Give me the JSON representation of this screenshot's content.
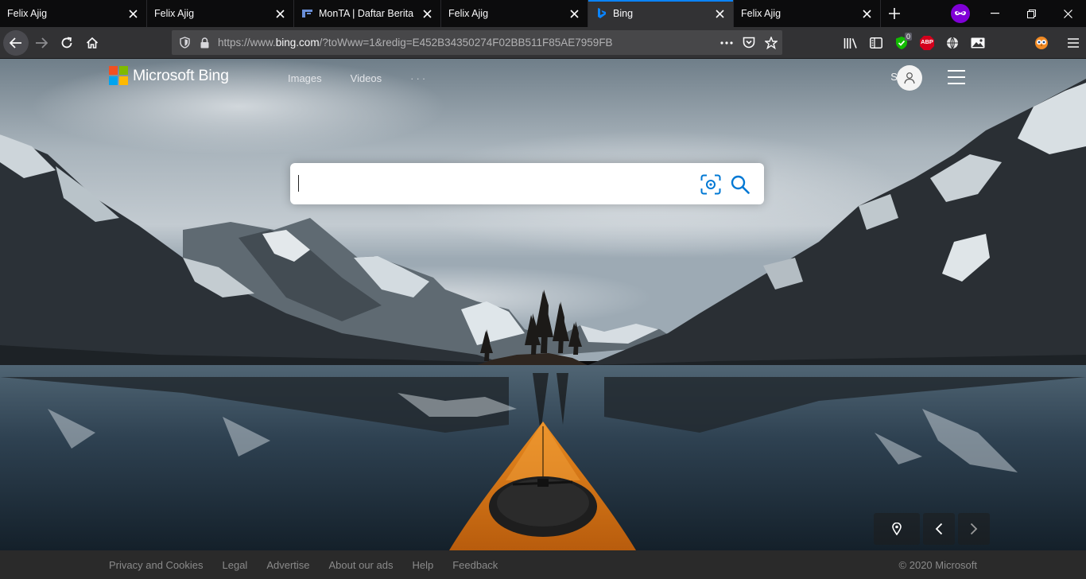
{
  "browser": {
    "tabs": [
      {
        "title": "Felix Ajig",
        "icon": "none",
        "active": false
      },
      {
        "title": "Felix Ajig",
        "icon": "none",
        "active": false
      },
      {
        "title": "MonTA | Daftar Berita",
        "icon": "monta-icon",
        "active": false
      },
      {
        "title": "Felix Ajig",
        "icon": "none",
        "active": false
      },
      {
        "title": "Bing",
        "icon": "bing-icon",
        "active": true
      },
      {
        "title": "Felix Ajig",
        "icon": "none",
        "active": false
      }
    ],
    "url_prefix": "https://www.",
    "url_host": "bing.com",
    "url_rest": "/?toWww=1&redig=E452B34350274F02BB511F85AE7959FB",
    "extension_badge": "0",
    "abp_label": "ABP"
  },
  "bing": {
    "brand": "Microsoft Bing",
    "nav": [
      "Images",
      "Videos"
    ],
    "more": "···",
    "signin": "Sign in",
    "search_value": "",
    "logo_colors": [
      "#f25022",
      "#7fba00",
      "#00a4ef",
      "#ffb900"
    ],
    "accent": "#0078d4"
  },
  "footer": {
    "links": [
      "Privacy and Cookies",
      "Legal",
      "Advertise",
      "About our ads",
      "Help",
      "Feedback"
    ],
    "copyright": "© 2020 Microsoft"
  }
}
